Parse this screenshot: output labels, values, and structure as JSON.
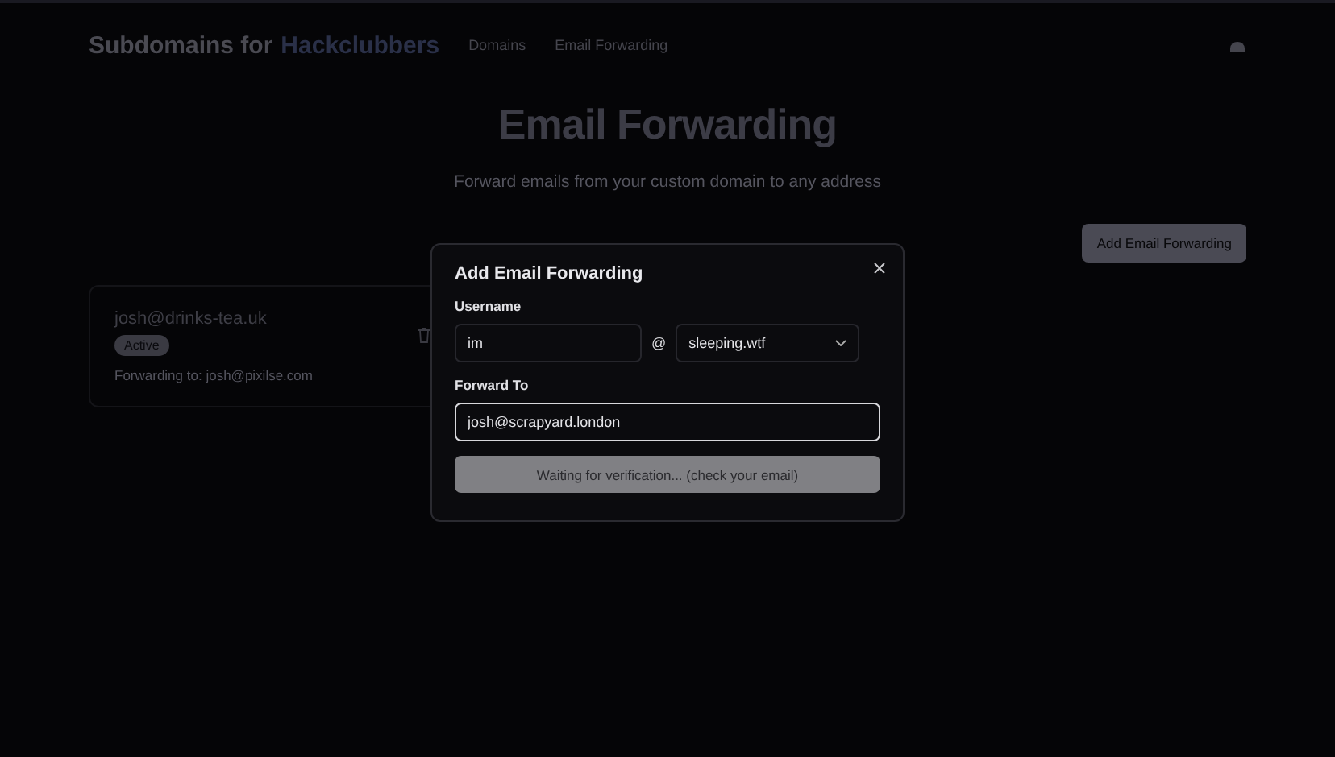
{
  "header": {
    "brand": "Subdomains for",
    "brand_highlight": "Hackclubbers",
    "nav": [
      {
        "label": "Domains"
      },
      {
        "label": "Email Forwarding"
      }
    ]
  },
  "hero": {
    "title": "Email Forwarding",
    "subtitle": "Forward emails from your custom domain to any address"
  },
  "add_button": "Add Email Forwarding",
  "forwardings": [
    {
      "address": "josh@drinks-tea.uk",
      "status": "Active",
      "forwarding_label": "Forwarding to:",
      "target": "josh@pixilse.com"
    }
  ],
  "dialog": {
    "title": "Add Email Forwarding",
    "username_label": "Username",
    "username": "im",
    "at": "@",
    "domain": "sleeping.wtf",
    "forward_label": "Forward To",
    "forward_to": "josh@scrapyard.london",
    "submit": "Waiting for verification... (check your email)",
    "submit_disabled": true
  }
}
